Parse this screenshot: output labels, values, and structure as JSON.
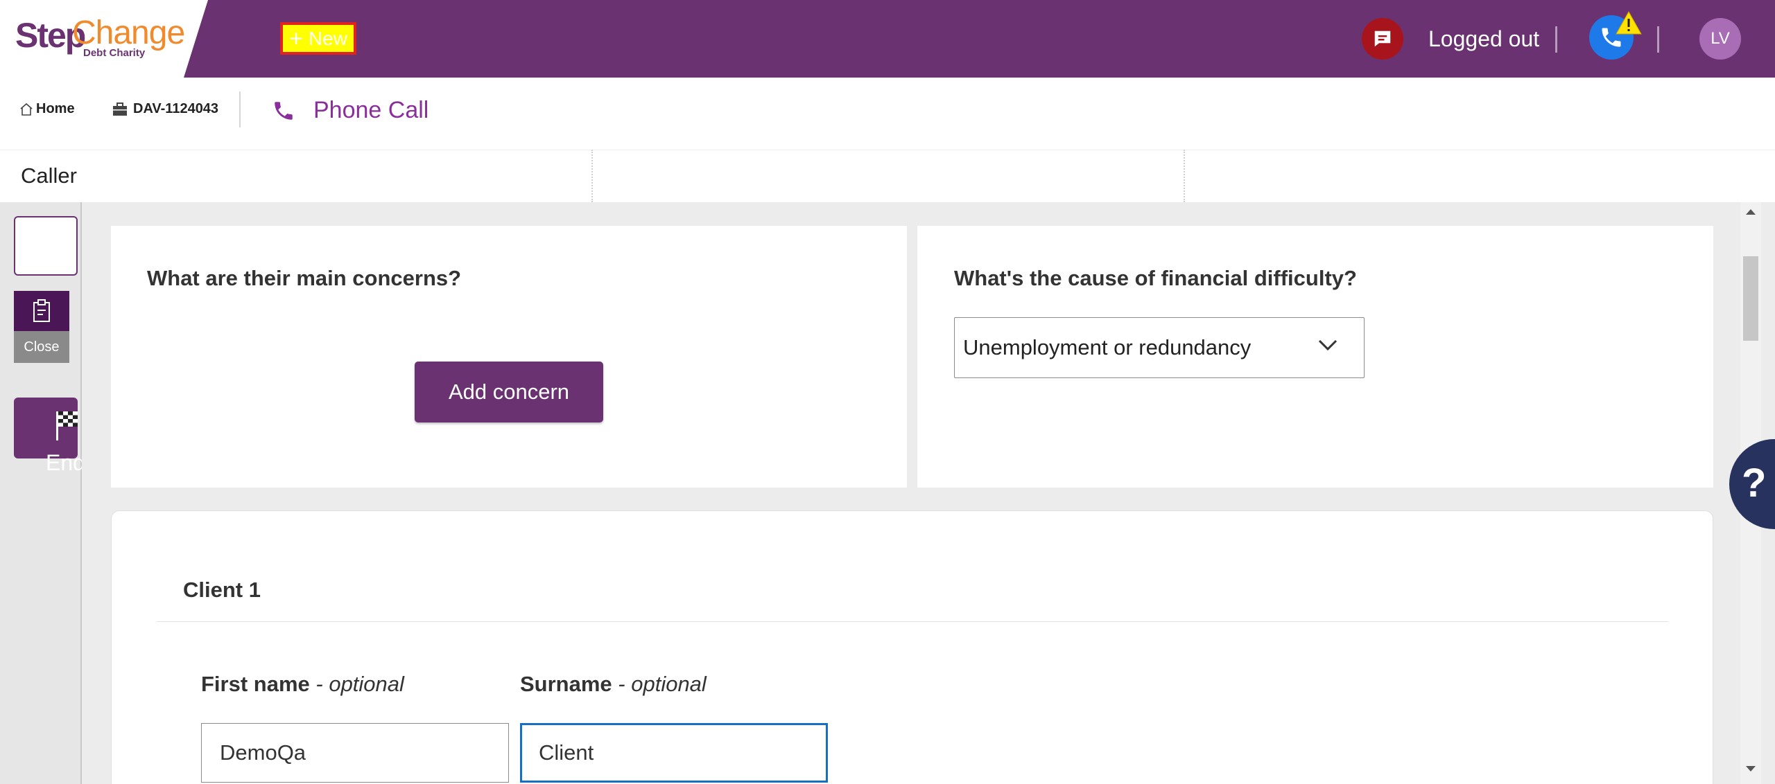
{
  "header": {
    "logo_step": "Step",
    "logo_change": "Change",
    "logo_sub": "Debt Charity",
    "new_label": "New",
    "status": "Logged out",
    "avatar_initials": "LV"
  },
  "breadcrumb": {
    "home": "Home",
    "case": "DAV-1124043",
    "call": "Phone Call"
  },
  "caller": {
    "label": "Caller"
  },
  "rail": {
    "close_label": "Close",
    "end_session_label": "End Session"
  },
  "concerns": {
    "question": "What are their main concerns?",
    "add_button": "Add concern"
  },
  "difficulty": {
    "question": "What's the cause of financial difficulty?",
    "selected": "Unemployment or redundancy"
  },
  "client": {
    "title": "Client 1",
    "first_name_label": "First name",
    "surname_label": "Surname",
    "optional": " - optional",
    "first_name_value": "DemoQa",
    "surname_value": "Client"
  },
  "help": {
    "label": "?"
  },
  "colors": {
    "brand_purple": "#6b3272",
    "accent_orange": "#f08a2c",
    "focus_blue": "#1570c4",
    "highlight_yellow": "#ffff00"
  }
}
